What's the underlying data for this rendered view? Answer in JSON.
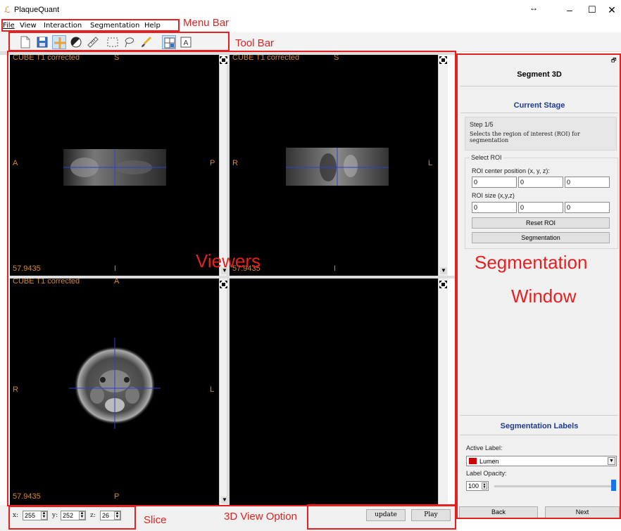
{
  "window": {
    "title": "PlaqueQuant",
    "resize_glyph": "↔",
    "minimize_glyph": "–",
    "maximize_glyph": "☐",
    "close_glyph": "✕"
  },
  "menu": {
    "items": [
      "File",
      "View",
      "Interaction",
      "Segmentation",
      "Help"
    ]
  },
  "toolbar": {
    "icons": [
      "new-file-icon",
      "save-icon",
      "crosshair-icon",
      "window-level-icon",
      "ruler-icon",
      "rectangle-select-icon",
      "lasso-icon",
      "brush-icon",
      "layout-icon",
      "text-icon"
    ],
    "text_tool_glyph": "A"
  },
  "viewers": [
    {
      "series": "CUBE T1 corrected",
      "top": "S",
      "left": "A",
      "right": "P",
      "bottom": "I",
      "value": "57.9435"
    },
    {
      "series": "CUBE T1 corrected",
      "top": "S",
      "left": "R",
      "right": "L",
      "bottom": "I",
      "value": "57.9435"
    },
    {
      "series": "CUBE T1 corrected",
      "top": "A",
      "left": "R",
      "right": "L",
      "bottom": "P",
      "value": "57.9435"
    }
  ],
  "panel": {
    "title": "Segment 3D",
    "stage_header": "Current Stage",
    "step": "Step 1/5",
    "step_desc": "Selects the region of interest (ROI) for segmentation",
    "select_roi": "Select ROI",
    "roi_center_label": "ROI center position (x, y, z):",
    "roi_center": [
      "0",
      "0",
      "0"
    ],
    "roi_size_label": "ROI size (x,y,z)",
    "roi_size": [
      "0",
      "0",
      "0"
    ],
    "reset_roi": "Reset ROI",
    "segmentation_btn": "Segmentation",
    "labels_header": "Segmentation Labels",
    "active_label_caption": "Active Label:",
    "active_label": "Lumen",
    "active_label_color": "#cc0000",
    "opacity_caption": "Label Opacity:",
    "opacity_value": "100",
    "back": "Back",
    "next": "Next",
    "float_glyph": "🗗"
  },
  "slice": {
    "x_label": "x:",
    "x": "255",
    "y_label": "y:",
    "y": "252",
    "z_label": "z:",
    "z": "26"
  },
  "view3d": {
    "update": "update",
    "play": "Play"
  },
  "annotations": {
    "menu_bar": "Menu Bar",
    "tool_bar": "Tool Bar",
    "viewers": "Viewers",
    "seg_line1": "Segmentation",
    "seg_line2": "Window",
    "slice": "Slice",
    "view3d_option": "3D View Option",
    "color": "#e52020"
  },
  "colors": {
    "overlay_text": "#d88a2b",
    "crosshair": "#2a3fd8",
    "panel_header": "#1f3a93"
  }
}
